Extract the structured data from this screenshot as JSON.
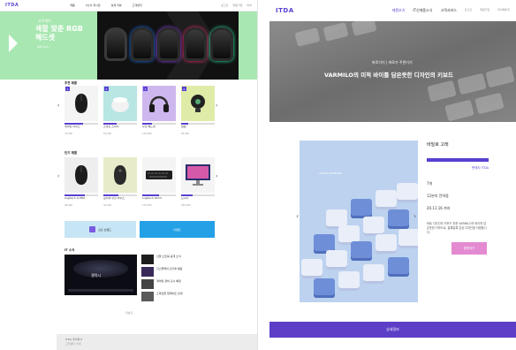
{
  "left": {
    "header": {
      "logo": "ITDA",
      "nav": [
        "제품",
        "it소식 게시판",
        "실제 리뷰",
        "고객센터"
      ],
      "user_links": [
        "로그인",
        "회원가입",
        "마이"
      ]
    },
    "hero": {
      "kicker": "코르세어",
      "title": "색깔 맞춘 RGB 헤드셋",
      "subtitle": "최대 30%"
    },
    "section1": {
      "title": "추천 제품",
      "products": [
        {
          "rank": "1",
          "name": "게이밍 마우스",
          "price": "79,000",
          "progress": 0.55,
          "img_color": "#f4f4f4",
          "obj": "mouse"
        },
        {
          "rank": "2",
          "name": "스마트 스피커",
          "price": "59,000",
          "progress": 0.4,
          "img_color": "#b8e6e2",
          "obj": "speaker"
        },
        {
          "rank": "3",
          "name": "무선 헤드셋",
          "price": "129,000",
          "progress": 0.3,
          "img_color": "#cdb7ee",
          "obj": "headset"
        },
        {
          "rank": "4",
          "name": "웹캠",
          "price": "89,000",
          "progress": 0.2,
          "img_color": "#dfeca8",
          "obj": "webcam"
        }
      ]
    },
    "section2": {
      "title": "인기 제품",
      "products": [
        {
          "name": "Logitech G PRO",
          "price": "99,000",
          "progress": 0.6,
          "img_color": "#eeeeee",
          "obj": "mouse"
        },
        {
          "name": "로지텍 무선 마우스",
          "price": "39,000",
          "progress": 0.45,
          "img_color": "#e7ebc9",
          "obj": "mouse2"
        },
        {
          "name": "Logitech G513",
          "price": "159,000",
          "progress": 0.5,
          "img_color": "#f4f4f4",
          "obj": "keyboard"
        },
        {
          "name": "모니터",
          "price": "299,000",
          "progress": 0.35,
          "img_color": "#f4f4f4",
          "obj": "monitor"
        }
      ]
    },
    "banners": {
      "left": "신규 브랜드",
      "right": "이벤트"
    },
    "news": {
      "title": "IT 소식",
      "main_caption": "갤럭시",
      "items": [
        "신형 노트북 공개 소식",
        "디스플레이 신기술 발표",
        "게이밍 장비 출시 예정",
        "스마트폰 업데이트 안내"
      ],
      "more": "더보기"
    },
    "footer": {
      "line1": "ITDA 주식회사",
      "line2": "고객센터 안내"
    }
  },
  "right": {
    "header": {
      "logo": "ITDA",
      "nav": [
        "제품보기",
        "IT신제품소식",
        "고객서비스",
        "로그인",
        "회원가입",
        "마이페이지"
      ],
      "active": 0
    },
    "hero": {
      "sub": "바로가기 | 바로가 주변기기",
      "title": "VARMILO의 미적 바이를 담은듯한 디자인의 키보드"
    },
    "product": {
      "image_caption": "VARMILO KEYBOARD",
      "name": "바밀로 고래",
      "company": "판매사 ITDA",
      "spec1": "7개",
      "spec2": "12분의 잔여중",
      "spec3": "20.11.16 까지",
      "description": "바로 디자인의 키보드 전문 VARMILO의 바이를 담은듯한 키보드로, 알록달록 감성 디자인을 자랑합니다.",
      "buy_label": "응원하기"
    },
    "footer": {
      "label": "상세정보"
    }
  }
}
